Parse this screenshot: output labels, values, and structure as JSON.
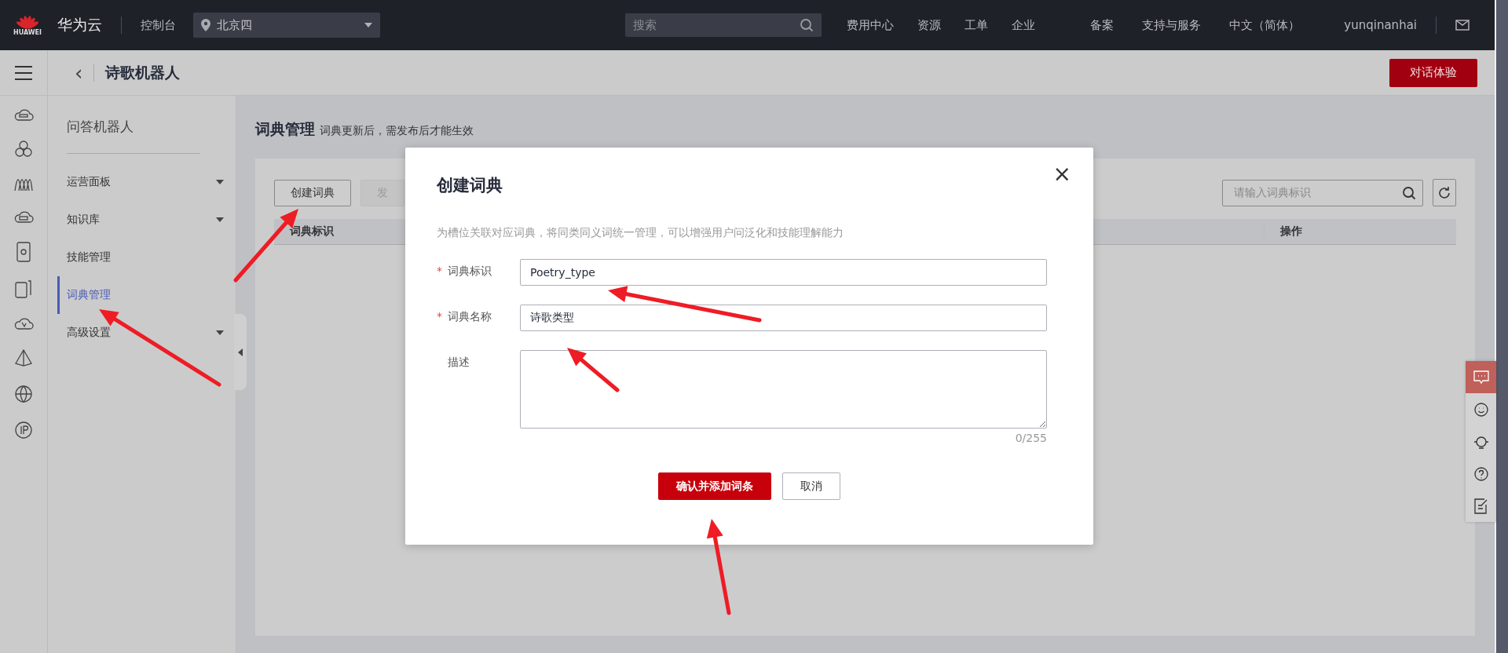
{
  "top_bar": {
    "brand": "HUAWEI",
    "product": "华为云",
    "console": "控制台",
    "region": "北京四",
    "search_placeholder": "搜索",
    "nav": [
      "费用中心",
      "资源",
      "工单",
      "企业",
      "备案",
      "支持与服务",
      "中文（简体）"
    ],
    "user": "yunqinanhai"
  },
  "header": {
    "back": "‹",
    "title": "诗歌机器人",
    "action": "对话体验"
  },
  "side_nav": {
    "title": "问答机器人",
    "items": [
      {
        "label": "运营面板",
        "expandable": true,
        "selected": false
      },
      {
        "label": "知识库",
        "expandable": true,
        "selected": false
      },
      {
        "label": "技能管理",
        "expandable": false,
        "selected": false
      },
      {
        "label": "词典管理",
        "expandable": false,
        "selected": true
      },
      {
        "label": "高级设置",
        "expandable": true,
        "selected": false
      }
    ]
  },
  "page": {
    "title": "词典管理",
    "hint": "词典更新后，需发布后才能生效",
    "buttons": [
      {
        "label": "创建词典",
        "disabled": false
      },
      {
        "label": "发",
        "disabled": true
      }
    ],
    "search": {
      "placeholder": "请输入词典标识"
    },
    "columns": [
      "词典标识",
      "操作"
    ]
  },
  "dialog": {
    "title": "创建词典",
    "close": "×",
    "description": "为槽位关联对应词典，将同类同义词统一管理，可以增强用户问泛化和技能理解能力",
    "fields": [
      {
        "kind": "input",
        "label": "词典标识",
        "required_mark": "*",
        "value": "Poetry_type"
      },
      {
        "kind": "input",
        "label": "词典名称",
        "required_mark": "*",
        "value": "诗歌类型"
      },
      {
        "kind": "textarea",
        "label": "描述",
        "counter": "0/255"
      }
    ],
    "buttons": [
      {
        "label": "确认并添加词条",
        "primary": true
      },
      {
        "label": "取消",
        "primary": false
      }
    ]
  },
  "float_toolbar": [
    {
      "selected": true
    },
    {
      "selected": false
    },
    {
      "selected": false
    },
    {
      "selected": false
    },
    {
      "selected": false
    }
  ]
}
